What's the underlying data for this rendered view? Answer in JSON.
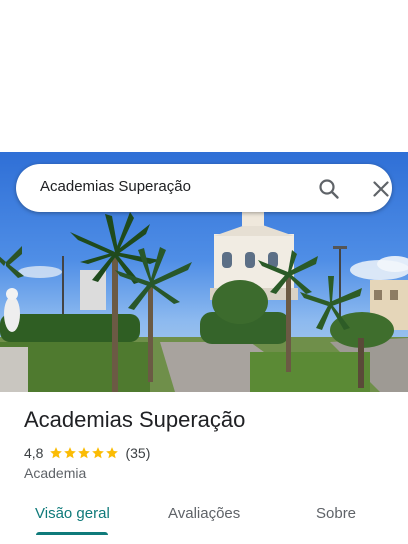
{
  "search": {
    "query": "Academias Superação",
    "search_icon": "search-icon",
    "close_icon": "close-icon"
  },
  "photo": {
    "icon": "place-photo"
  },
  "place": {
    "title": "Academias Superação",
    "rating": "4,8",
    "stars": 5,
    "review_count": "(35)",
    "category": "Academia"
  },
  "tabs": [
    {
      "label": "Visão geral",
      "active": true
    },
    {
      "label": "Avaliações",
      "active": false
    },
    {
      "label": "Sobre",
      "active": false
    }
  ],
  "colors": {
    "accent": "#0f7a7a",
    "star": "#fbbc04",
    "text": "#202124",
    "muted": "#5f6368"
  }
}
